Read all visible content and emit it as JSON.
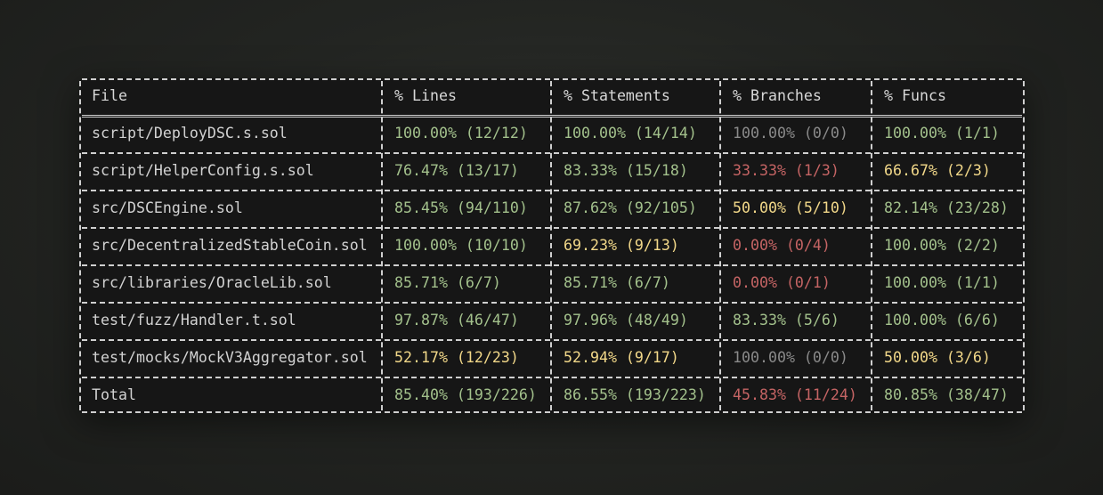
{
  "colors": {
    "high": "#a3c18c",
    "medium": "#f2d889",
    "low": "#c56464",
    "none": "#8a8a8a",
    "text": "#d2d2d2",
    "background": "#161616"
  },
  "table": {
    "headers": [
      "File",
      "% Lines",
      "% Statements",
      "% Branches",
      "% Funcs"
    ],
    "rows": [
      {
        "file": "script/DeployDSC.s.sol",
        "lines": {
          "text": "100.00% (12/12)",
          "level": "green"
        },
        "statements": {
          "text": "100.00% (14/14)",
          "level": "green"
        },
        "branches": {
          "text": "100.00% (0/0)",
          "level": "gray"
        },
        "funcs": {
          "text": "100.00% (1/1)",
          "level": "green"
        }
      },
      {
        "file": "script/HelperConfig.s.sol",
        "lines": {
          "text": "76.47% (13/17)",
          "level": "green"
        },
        "statements": {
          "text": "83.33% (15/18)",
          "level": "green"
        },
        "branches": {
          "text": "33.33% (1/3)",
          "level": "red"
        },
        "funcs": {
          "text": "66.67% (2/3)",
          "level": "yellow"
        }
      },
      {
        "file": "src/DSCEngine.sol",
        "lines": {
          "text": "85.45% (94/110)",
          "level": "green"
        },
        "statements": {
          "text": "87.62% (92/105)",
          "level": "green"
        },
        "branches": {
          "text": "50.00% (5/10)",
          "level": "yellow"
        },
        "funcs": {
          "text": "82.14% (23/28)",
          "level": "green"
        }
      },
      {
        "file": "src/DecentralizedStableCoin.sol",
        "lines": {
          "text": "100.00% (10/10)",
          "level": "green"
        },
        "statements": {
          "text": "69.23% (9/13)",
          "level": "yellow"
        },
        "branches": {
          "text": "0.00% (0/4)",
          "level": "red"
        },
        "funcs": {
          "text": "100.00% (2/2)",
          "level": "green"
        }
      },
      {
        "file": "src/libraries/OracleLib.sol",
        "lines": {
          "text": "85.71% (6/7)",
          "level": "green"
        },
        "statements": {
          "text": "85.71% (6/7)",
          "level": "green"
        },
        "branches": {
          "text": "0.00% (0/1)",
          "level": "red"
        },
        "funcs": {
          "text": "100.00% (1/1)",
          "level": "green"
        }
      },
      {
        "file": "test/fuzz/Handler.t.sol",
        "lines": {
          "text": "97.87% (46/47)",
          "level": "green"
        },
        "statements": {
          "text": "97.96% (48/49)",
          "level": "green"
        },
        "branches": {
          "text": "83.33% (5/6)",
          "level": "green"
        },
        "funcs": {
          "text": "100.00% (6/6)",
          "level": "green"
        }
      },
      {
        "file": "test/mocks/MockV3Aggregator.sol",
        "lines": {
          "text": "52.17% (12/23)",
          "level": "yellow"
        },
        "statements": {
          "text": "52.94% (9/17)",
          "level": "yellow"
        },
        "branches": {
          "text": "100.00% (0/0)",
          "level": "gray"
        },
        "funcs": {
          "text": "50.00% (3/6)",
          "level": "yellow"
        }
      },
      {
        "file": "Total",
        "lines": {
          "text": "85.40% (193/226)",
          "level": "green"
        },
        "statements": {
          "text": "86.55% (193/223)",
          "level": "green"
        },
        "branches": {
          "text": "45.83% (11/24)",
          "level": "red"
        },
        "funcs": {
          "text": "80.85% (38/47)",
          "level": "green"
        }
      }
    ]
  }
}
